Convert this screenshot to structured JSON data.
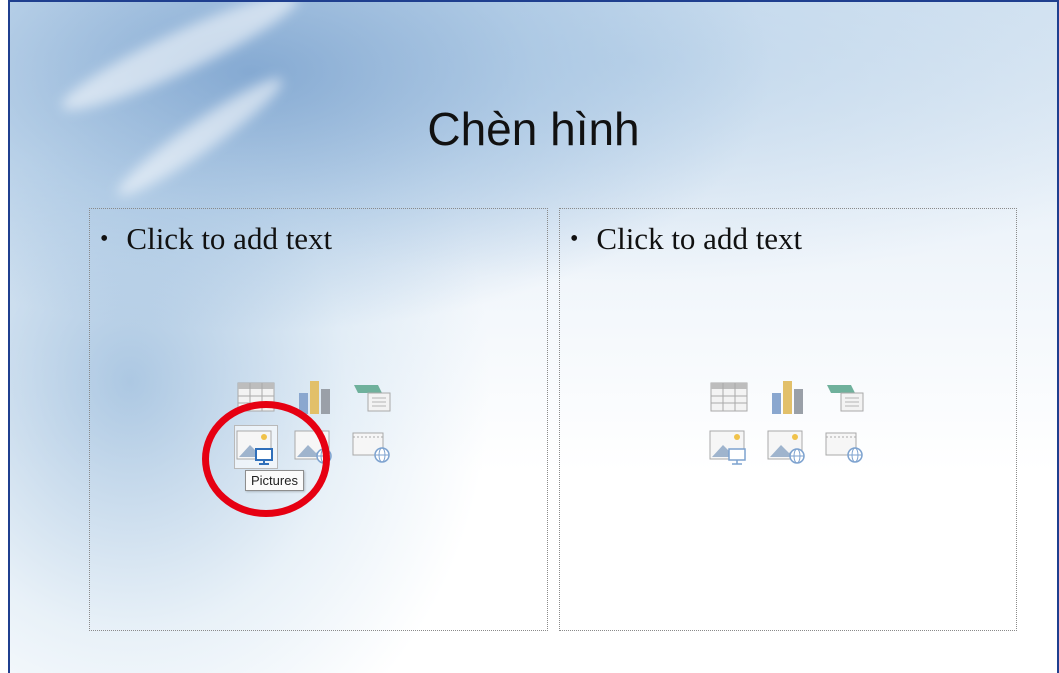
{
  "slide": {
    "title": "Chèn hình",
    "placeholders": [
      {
        "bullet": "•",
        "prompt": "Click to add text"
      },
      {
        "bullet": "•",
        "prompt": "Click to add text"
      }
    ],
    "content_icons": [
      "table-icon",
      "chart-icon",
      "smartart-icon",
      "pictures-icon",
      "online-pictures-icon",
      "video-icon"
    ],
    "tooltip": "Pictures"
  },
  "annotation": {
    "highlight_color": "#e60012",
    "target": "pictures-icon"
  }
}
